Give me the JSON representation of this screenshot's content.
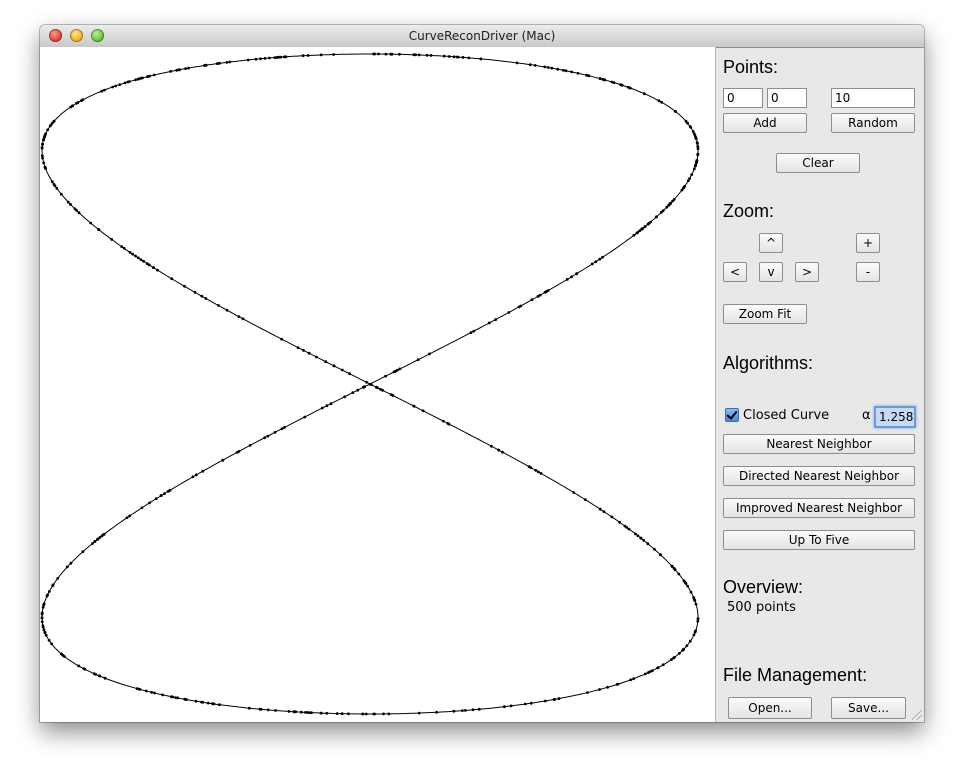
{
  "window": {
    "title": "CurveReconDriver (Mac)"
  },
  "points": {
    "heading": "Points:",
    "x_value": "0",
    "y_value": "0",
    "count_value": "10",
    "add_label": "Add",
    "random_label": "Random",
    "clear_label": "Clear"
  },
  "zoom": {
    "heading": "Zoom:",
    "up_label": "^",
    "left_label": "<",
    "down_label": "v",
    "right_label": ">",
    "plus_label": "+",
    "minus_label": "-",
    "fit_label": "Zoom Fit"
  },
  "algorithms": {
    "heading": "Algorithms:",
    "closed_curve_label": "Closed Curve",
    "closed_curve_checked": true,
    "alpha_symbol": "α",
    "alpha_value": "1.258",
    "nearest_neighbor_label": "Nearest Neighbor",
    "directed_nearest_neighbor_label": "Directed Nearest Neighbor",
    "improved_nearest_neighbor_label": "Improved Nearest Neighbor",
    "up_to_five_label": "Up To Five"
  },
  "overview": {
    "heading": "Overview:",
    "summary": "500 points"
  },
  "file": {
    "heading": "File Management:",
    "open_label": "Open...",
    "save_label": "Save..."
  },
  "canvas": {
    "point_count": 500,
    "curve": "figure-eight",
    "stroke": "#000000"
  }
}
